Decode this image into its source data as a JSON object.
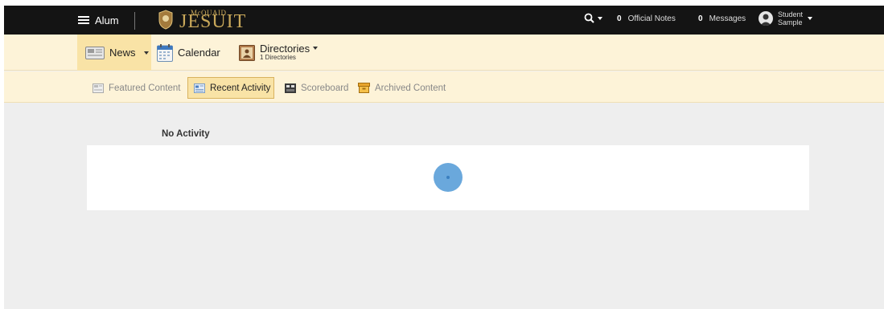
{
  "topbar": {
    "menu_label": "Alum",
    "logo_small": "McQUAID",
    "logo_big": "JESUIT",
    "official_notes_count": "0",
    "official_notes_label": "Official Notes",
    "messages_count": "0",
    "messages_label": "Messages",
    "user_first": "Student",
    "user_last": "Sample"
  },
  "nav": {
    "news": "News",
    "calendar": "Calendar",
    "directories": "Directories",
    "directories_sub": "1 Directories"
  },
  "subnav": {
    "featured": "Featured Content",
    "recent": "Recent Activity",
    "scoreboard": "Scoreboard",
    "archived": "Archived Content"
  },
  "content": {
    "empty_message": "No Activity"
  },
  "colors": {
    "topbar": "#141414",
    "nav_bg": "#fdf3d8",
    "active_tab": "#f9e3a6",
    "spinner": "#6aa8dc"
  }
}
